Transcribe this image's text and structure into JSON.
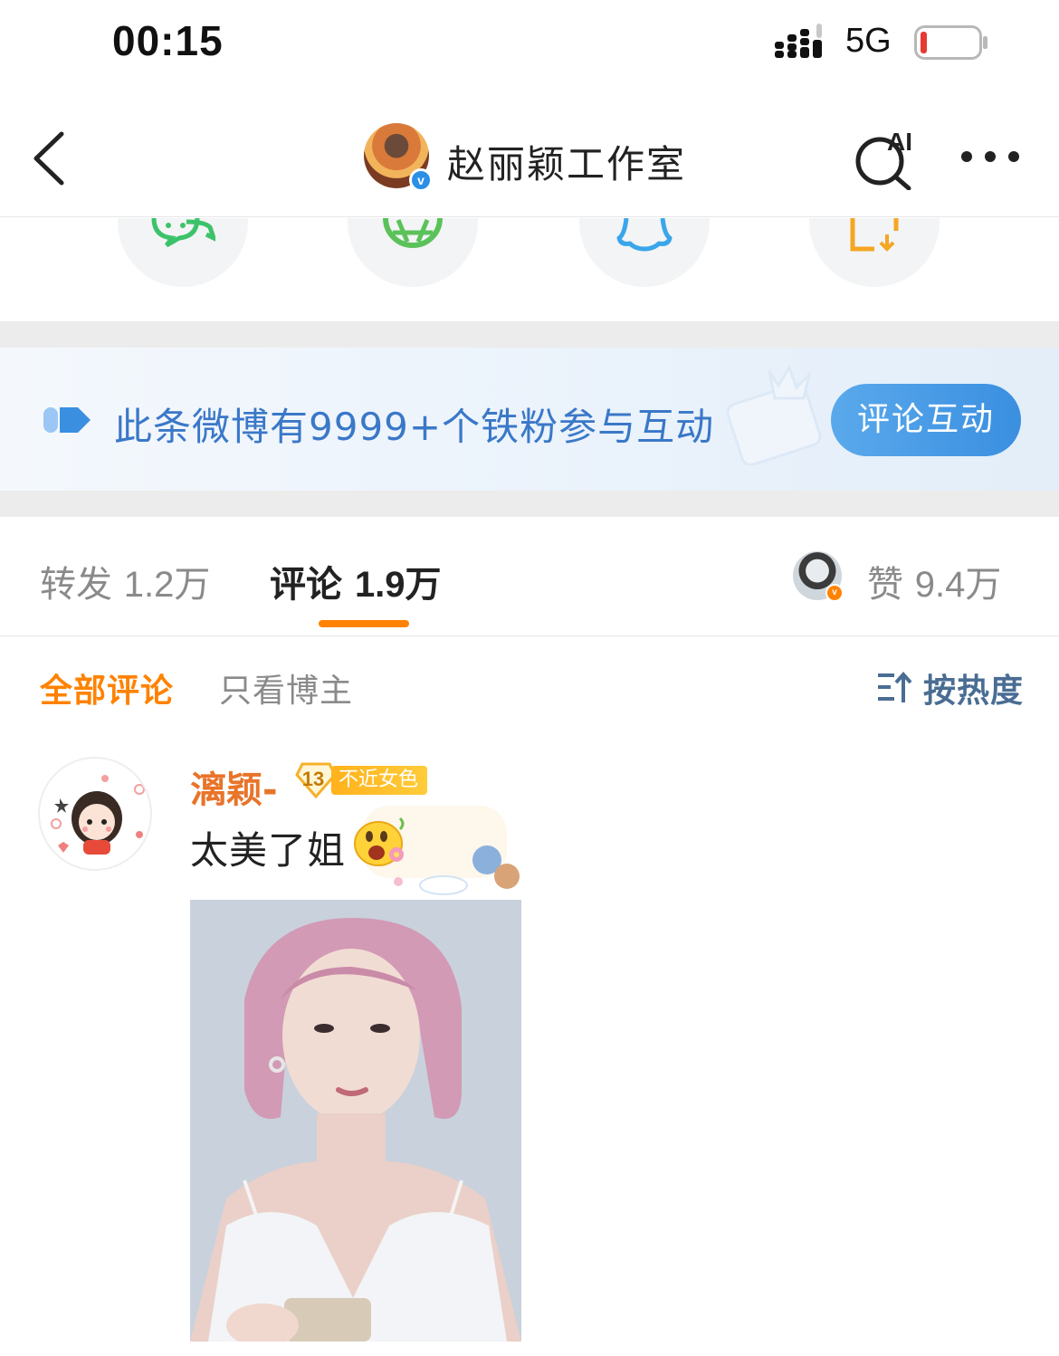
{
  "status_bar": {
    "time": "00:15",
    "network": "5G",
    "battery_level": 0.1,
    "battery_color": "#e53935"
  },
  "header": {
    "account_name": "赵丽颖工作室",
    "ai_label": "AI",
    "verified_color": "#2b8fe6"
  },
  "share": {
    "items": [
      {
        "icon": "wechat-icon",
        "color": "#3cc36a"
      },
      {
        "icon": "moments-icon",
        "color": "#5bc25a"
      },
      {
        "icon": "qq-icon",
        "color": "#3aa6ea"
      },
      {
        "icon": "save-image-icon",
        "color": "#f5a623"
      }
    ]
  },
  "fan_banner": {
    "text": "此条微博有9999+个铁粉参与互动",
    "button_label": "评论互动",
    "accent": "#3a78c8"
  },
  "tabs": {
    "repost_label": "转发",
    "repost_count": "1.2万",
    "comment_label": "评论",
    "comment_count": "1.9万",
    "like_label": "赞",
    "like_count": "9.4万",
    "active_color": "#ff8200"
  },
  "filter": {
    "all_label": "全部评论",
    "host_label": "只看博主",
    "sort_label": "按热度"
  },
  "comment": {
    "username": "漓颖-",
    "fan_level": "13",
    "fan_tag": "不近女色",
    "text": "太美了姐",
    "emoji": "flower-face-emoji"
  }
}
